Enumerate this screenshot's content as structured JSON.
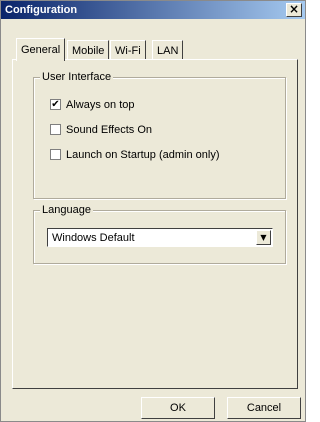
{
  "window": {
    "title": "Configuration",
    "close_glyph": "×"
  },
  "tabs": [
    {
      "label": "General",
      "active": true
    },
    {
      "label": "Mobile",
      "active": false
    },
    {
      "label": "Wi-Fi",
      "active": false
    },
    {
      "label": "LAN",
      "active": false
    }
  ],
  "user_interface": {
    "label": "User Interface",
    "options": [
      {
        "label": "Always on top",
        "checked": true,
        "mark": "✔"
      },
      {
        "label": "Sound Effects On",
        "checked": false,
        "mark": ""
      },
      {
        "label": "Launch on Startup (admin only)",
        "checked": false,
        "mark": ""
      }
    ]
  },
  "language": {
    "label": "Language",
    "selected": "Windows Default",
    "arrow_glyph": "▼"
  },
  "buttons": {
    "ok": "OK",
    "cancel": "Cancel"
  }
}
